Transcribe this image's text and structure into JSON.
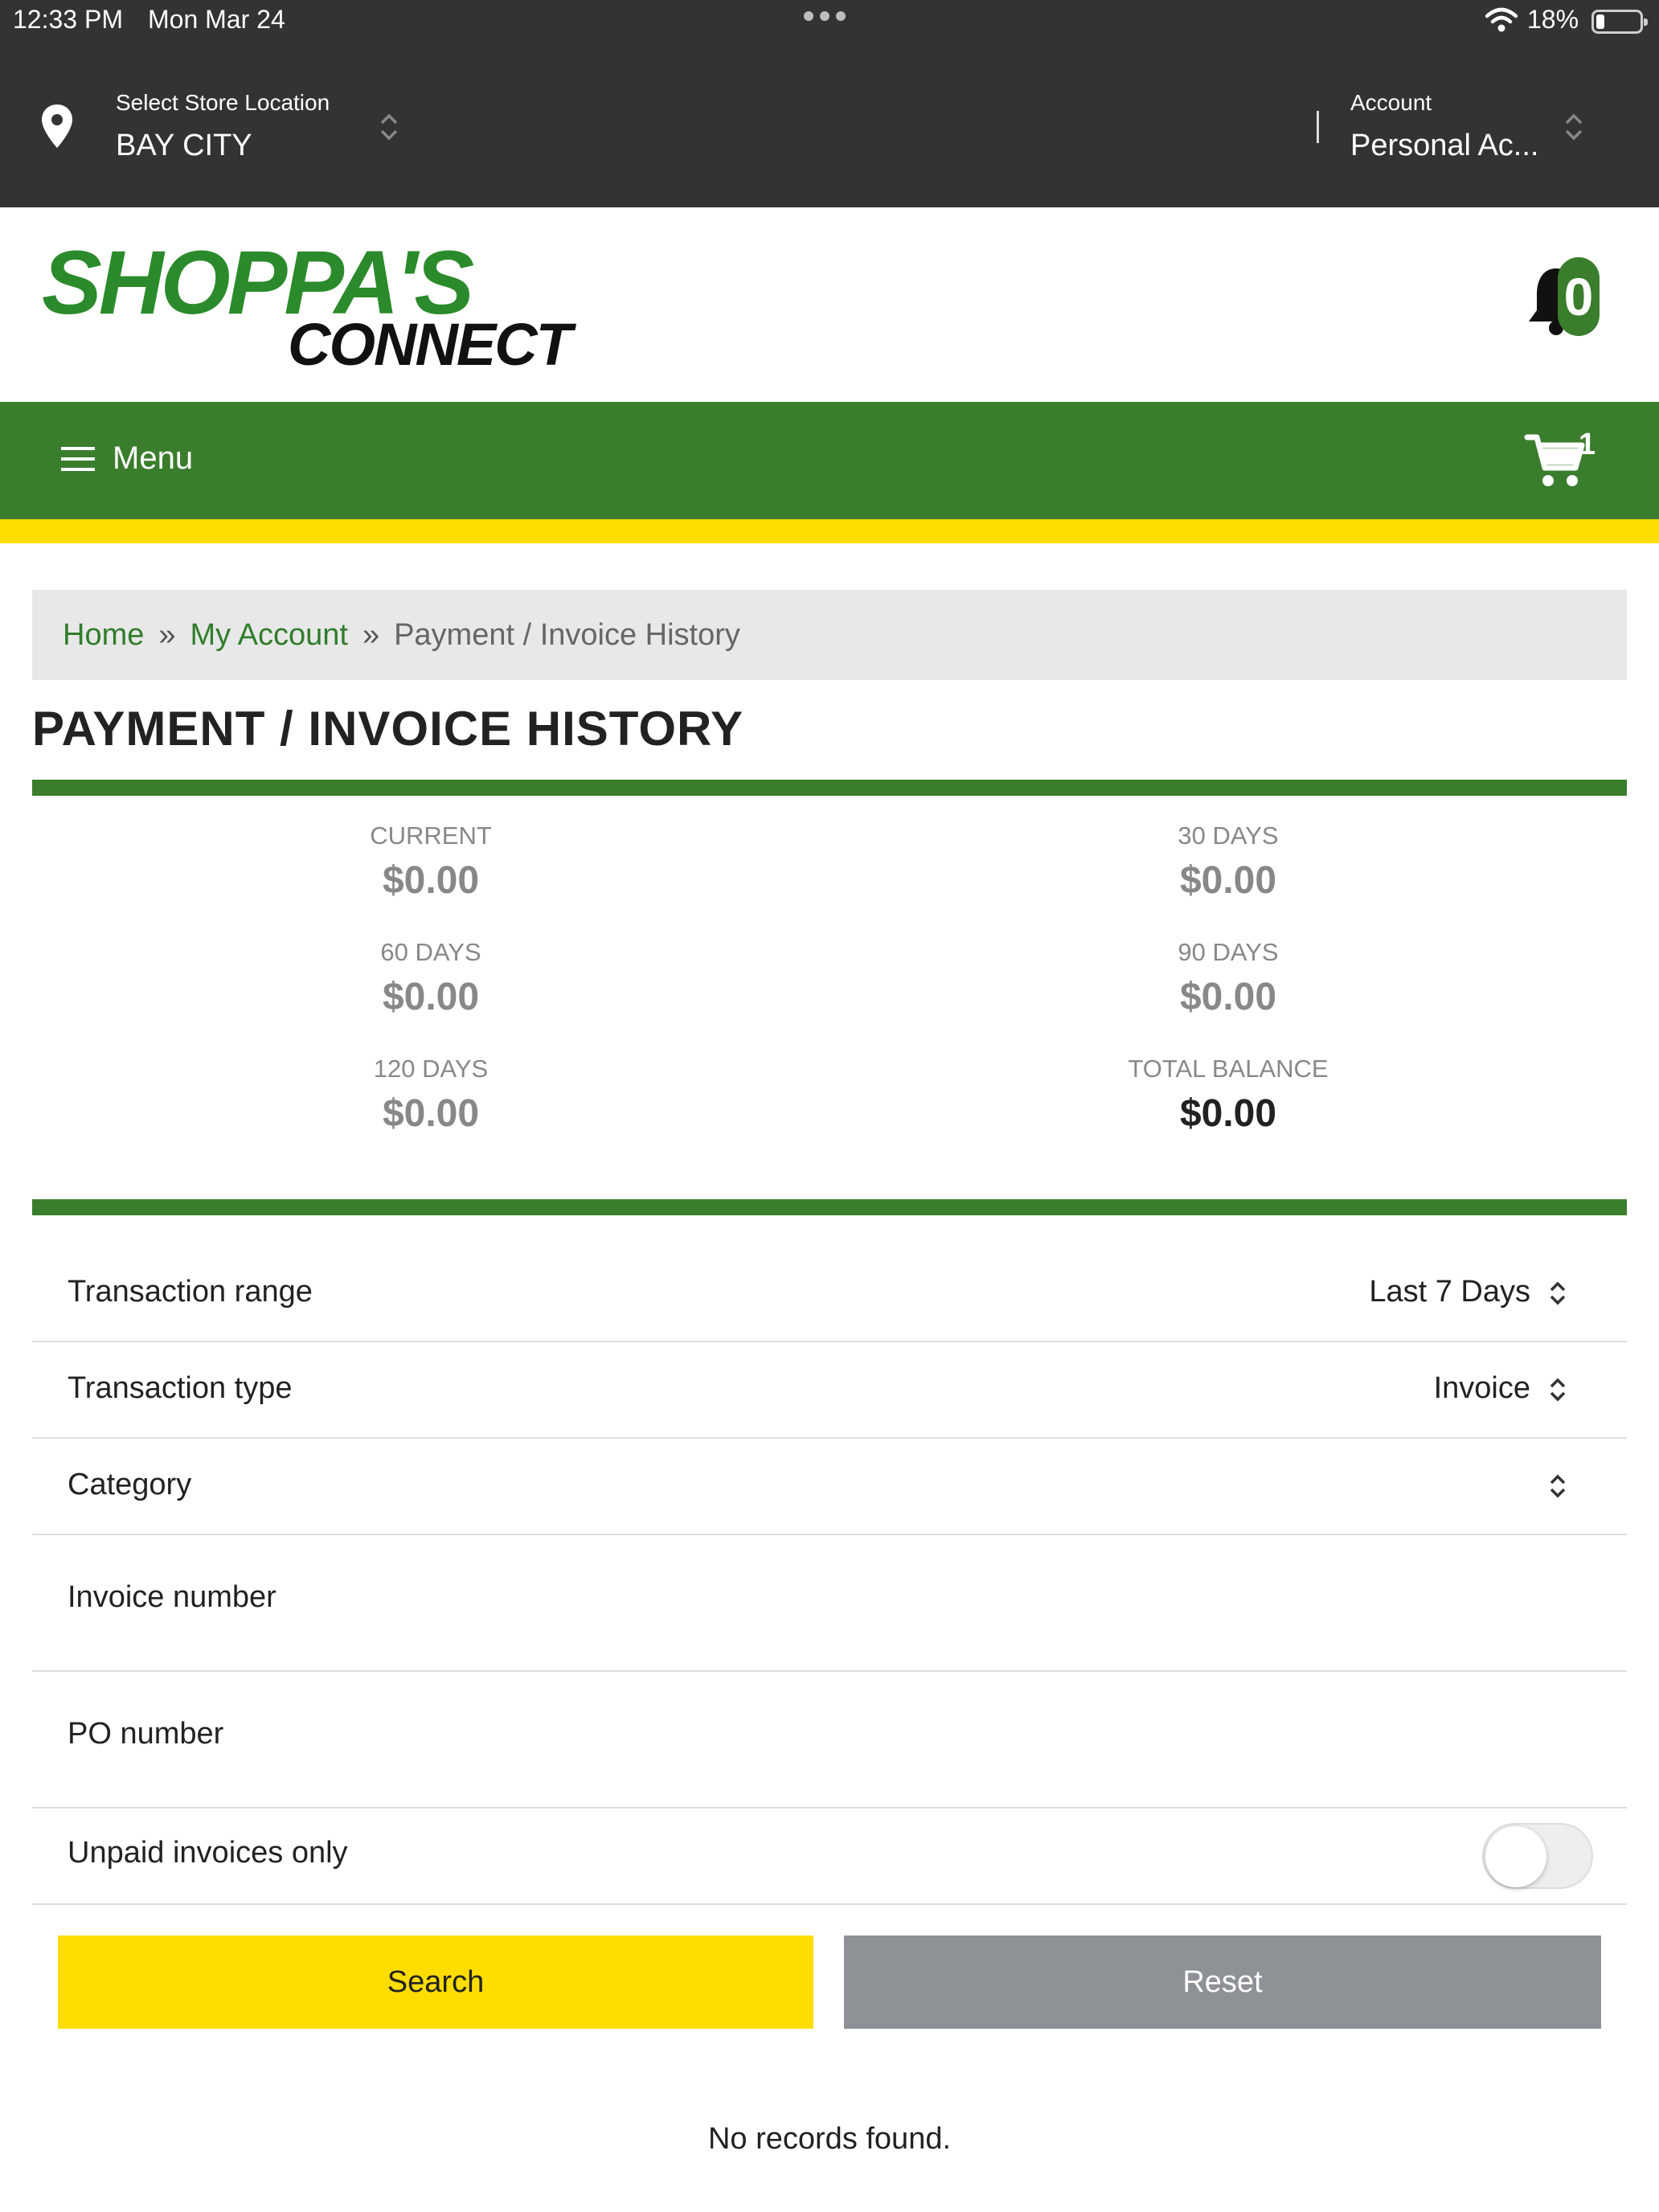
{
  "status_bar": {
    "time": "12:33 PM",
    "date": "Mon Mar 24",
    "battery": "18%"
  },
  "header": {
    "store_label": "Select Store Location",
    "store_value": "BAY CITY",
    "account_label": "Account",
    "account_value": "Personal Ac..."
  },
  "logo": {
    "line1": "SHOPPA'S",
    "line2": "CONNECT"
  },
  "notifications": {
    "count": "0"
  },
  "nav": {
    "menu_label": "Menu",
    "cart_count": "1"
  },
  "breadcrumb": {
    "home": "Home",
    "separator": "»",
    "my_account": "My Account",
    "current": "Payment / Invoice History"
  },
  "page_title": "PAYMENT / INVOICE HISTORY",
  "aging": [
    {
      "label": "CURRENT",
      "amount": "$0.00"
    },
    {
      "label": "30 DAYS",
      "amount": "$0.00"
    },
    {
      "label": "60 DAYS",
      "amount": "$0.00"
    },
    {
      "label": "90 DAYS",
      "amount": "$0.00"
    },
    {
      "label": "120 DAYS",
      "amount": "$0.00"
    },
    {
      "label": "TOTAL BALANCE",
      "amount": "$0.00"
    }
  ],
  "filters": {
    "transaction_range": {
      "label": "Transaction range",
      "value": "Last 7 Days"
    },
    "transaction_type": {
      "label": "Transaction type",
      "value": "Invoice"
    },
    "category": {
      "label": "Category",
      "value": ""
    },
    "invoice_number": {
      "label": "Invoice number"
    },
    "po_number": {
      "label": "PO number"
    },
    "unpaid_only": {
      "label": "Unpaid invoices only",
      "on": false
    }
  },
  "buttons": {
    "search": "Search",
    "reset": "Reset"
  },
  "empty_message": "No records found.",
  "colors": {
    "brand_green": "#3a7d2c",
    "brand_yellow": "#ffdd00",
    "header_dark": "#333333",
    "reset_gray": "#8e9196"
  }
}
